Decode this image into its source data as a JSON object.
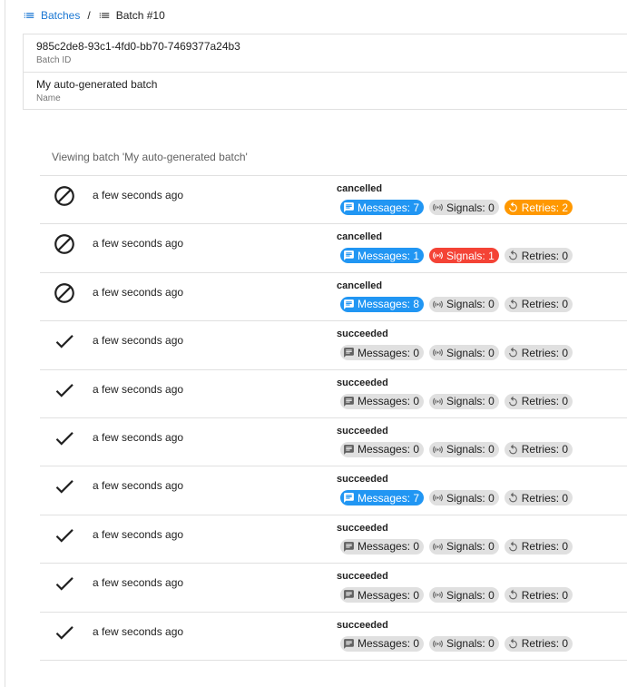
{
  "breadcrumb": {
    "parent_label": "Batches",
    "separator": "/",
    "current_label": "Batch #10"
  },
  "batch": {
    "id_value": "985c2de8-93c1-4fd0-bb70-7469377a24b3",
    "id_label": "Batch ID",
    "name_value": "My auto-generated batch",
    "name_label": "Name"
  },
  "viewing_text": "Viewing batch 'My auto-generated batch'",
  "colors": {
    "link": "#1976d2",
    "chip_default": "#e0e0e0",
    "chip_messages_active": "#2196f3",
    "chip_signals_active": "#f44336",
    "chip_retries_active": "#ff9800"
  },
  "rows": [
    {
      "icon": "cancelled-icon",
      "time": "a few seconds ago",
      "status": "cancelled",
      "messages": "Messages: 7",
      "signals": "Signals: 0",
      "retries": "Retries: 2",
      "messages_active": true,
      "signals_active": false,
      "retries_active": true
    },
    {
      "icon": "cancelled-icon",
      "time": "a few seconds ago",
      "status": "cancelled",
      "messages": "Messages: 1",
      "signals": "Signals: 1",
      "retries": "Retries: 0",
      "messages_active": true,
      "signals_active": true,
      "retries_active": false
    },
    {
      "icon": "cancelled-icon",
      "time": "a few seconds ago",
      "status": "cancelled",
      "messages": "Messages: 8",
      "signals": "Signals: 0",
      "retries": "Retries: 0",
      "messages_active": true,
      "signals_active": false,
      "retries_active": false
    },
    {
      "icon": "check-icon",
      "time": "a few seconds ago",
      "status": "succeeded",
      "messages": "Messages: 0",
      "signals": "Signals: 0",
      "retries": "Retries: 0",
      "messages_active": false,
      "signals_active": false,
      "retries_active": false
    },
    {
      "icon": "check-icon",
      "time": "a few seconds ago",
      "status": "succeeded",
      "messages": "Messages: 0",
      "signals": "Signals: 0",
      "retries": "Retries: 0",
      "messages_active": false,
      "signals_active": false,
      "retries_active": false
    },
    {
      "icon": "check-icon",
      "time": "a few seconds ago",
      "status": "succeeded",
      "messages": "Messages: 0",
      "signals": "Signals: 0",
      "retries": "Retries: 0",
      "messages_active": false,
      "signals_active": false,
      "retries_active": false
    },
    {
      "icon": "check-icon",
      "time": "a few seconds ago",
      "status": "succeeded",
      "messages": "Messages: 7",
      "signals": "Signals: 0",
      "retries": "Retries: 0",
      "messages_active": true,
      "signals_active": false,
      "retries_active": false
    },
    {
      "icon": "check-icon",
      "time": "a few seconds ago",
      "status": "succeeded",
      "messages": "Messages: 0",
      "signals": "Signals: 0",
      "retries": "Retries: 0",
      "messages_active": false,
      "signals_active": false,
      "retries_active": false
    },
    {
      "icon": "check-icon",
      "time": "a few seconds ago",
      "status": "succeeded",
      "messages": "Messages: 0",
      "signals": "Signals: 0",
      "retries": "Retries: 0",
      "messages_active": false,
      "signals_active": false,
      "retries_active": false
    },
    {
      "icon": "check-icon",
      "time": "a few seconds ago",
      "status": "succeeded",
      "messages": "Messages: 0",
      "signals": "Signals: 0",
      "retries": "Retries: 0",
      "messages_active": false,
      "signals_active": false,
      "retries_active": false
    }
  ]
}
